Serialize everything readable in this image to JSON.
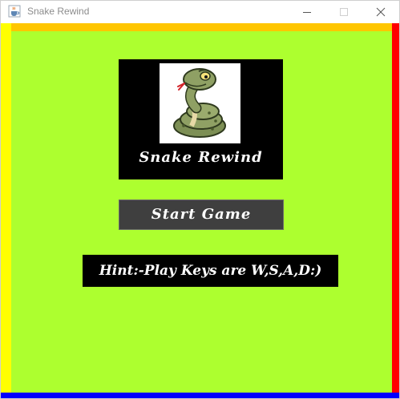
{
  "window": {
    "title": "Snake Rewind",
    "app_icon": "java-cup-icon",
    "controls": {
      "minimize_icon": "minimize-icon",
      "maximize_icon": "maximize-icon",
      "close_icon": "close-icon"
    }
  },
  "colors": {
    "playfield": "#adff2f",
    "border_top": "#ffc600",
    "border_left": "#ffff00",
    "border_right": "#ff0000",
    "border_bottom": "#0000ff",
    "logo_panel": "#000000",
    "start_button": "#3f3f3f",
    "hint_box": "#000000",
    "text": "#ffffff"
  },
  "menu": {
    "logo_image": "cartoon-snake-image",
    "logo_caption": "Snake Rewind",
    "start_button_label": "Start Game",
    "hint": "Hint:-Play Keys are W,S,A,D:)"
  }
}
